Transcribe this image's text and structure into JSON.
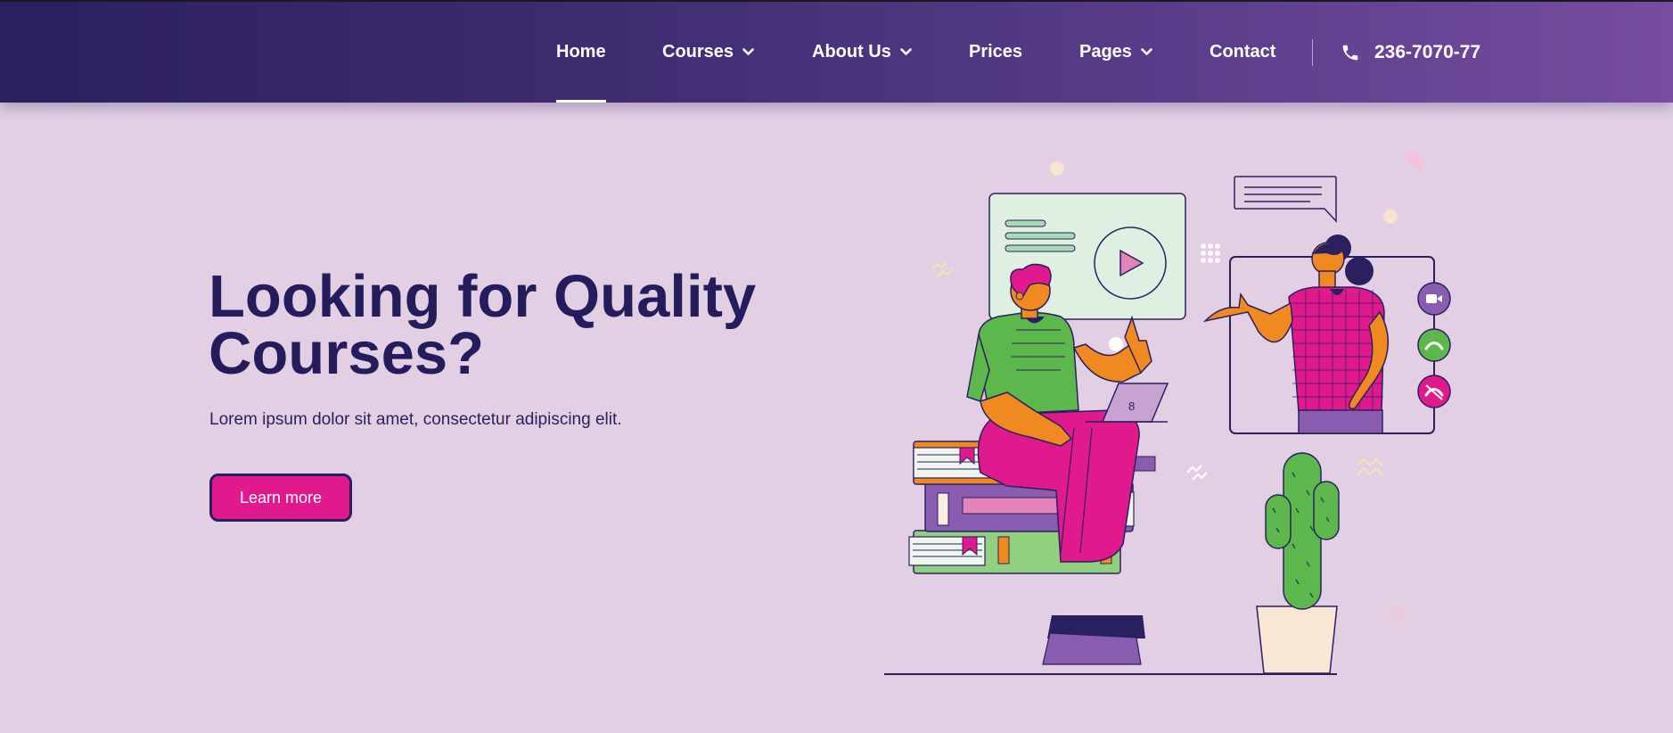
{
  "nav": {
    "items": [
      {
        "label": "Home",
        "active": true
      },
      {
        "label": "Courses",
        "dropdown": true
      },
      {
        "label": "About Us",
        "dropdown": true
      },
      {
        "label": "Prices"
      },
      {
        "label": "Pages",
        "dropdown": true
      },
      {
        "label": "Contact"
      }
    ],
    "phone": "236-7070-77",
    "phone_icon": "phone-icon",
    "dropdown_icon": "chevron-down-icon"
  },
  "hero": {
    "title": "Looking for Quality Courses?",
    "subtitle": "Lorem ipsum dolor sit amet, consectetur adipiscing elit.",
    "cta_label": "Learn more"
  },
  "colors": {
    "nav_start": "#2b1f60",
    "nav_end": "#774d9f",
    "background": "#e2cfe4",
    "heading": "#241c5c",
    "accent": "#e01a8c",
    "green": "#5cb84c",
    "orange": "#f0891f"
  }
}
